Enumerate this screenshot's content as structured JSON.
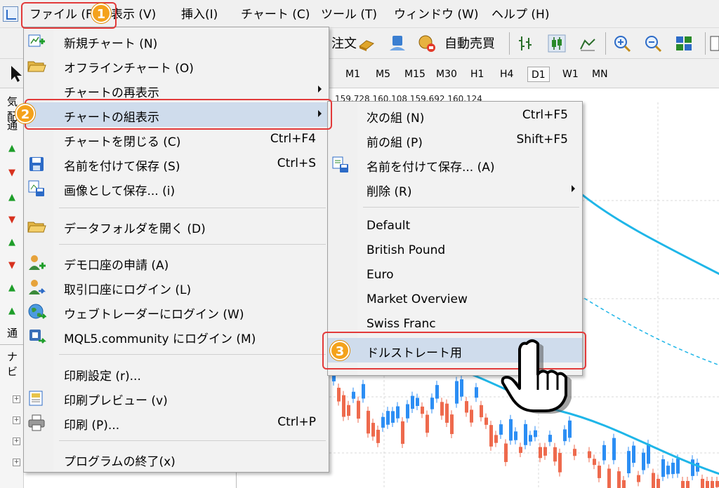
{
  "menubar": {
    "items": [
      "ファイル (F)",
      "表示 (V)",
      "挿入(I)",
      "チャート (C)",
      "ツール (T)",
      "ウィンドウ (W)",
      "ヘルプ (H)"
    ]
  },
  "toolbar": {
    "order_label": "注文",
    "auto_trade_label": "自動売買"
  },
  "timeframes": [
    "M1",
    "M5",
    "M15",
    "M30",
    "H1",
    "H4",
    "D1",
    "W1",
    "MN"
  ],
  "active_timeframe": "D1",
  "left_panel": {
    "market_watch_title": "気配",
    "tab_label": "通",
    "tab_label_2": "通",
    "navigator_title": "ナビ"
  },
  "chart": {
    "price_row": "159.728 160.108 159.692 160.124"
  },
  "file_menu": {
    "items": [
      {
        "label": "新規チャート (N)",
        "shortcut": "",
        "icon": "new-chart-icon"
      },
      {
        "label": "オフラインチャート (O)",
        "shortcut": "",
        "icon": "open-folder-icon"
      },
      {
        "label": "チャートの再表示",
        "shortcut": "",
        "icon": "none"
      },
      {
        "label": "チャートの組表示",
        "shortcut": "",
        "icon": "none"
      },
      {
        "label": "チャートを閉じる (C)",
        "shortcut": "Ctrl+F4",
        "icon": "none"
      },
      {
        "label": "名前を付けて保存 (S)",
        "shortcut": "Ctrl+S",
        "icon": "save-icon"
      },
      {
        "label": "画像として保存... (i)",
        "shortcut": "",
        "icon": "save-image-icon"
      },
      {
        "label": "データフォルダを開く (D)",
        "shortcut": "",
        "icon": "folder-icon"
      },
      {
        "label": "デモ口座の申請 (A)",
        "shortcut": "",
        "icon": "add-user-icon"
      },
      {
        "label": "取引口座にログイン (L)",
        "shortcut": "",
        "icon": "login-user-icon"
      },
      {
        "label": "ウェブトレーダーにログイン (W)",
        "shortcut": "",
        "icon": "globe-icon"
      },
      {
        "label": "MQL5.community にログイン (M)",
        "shortcut": "",
        "icon": "mql5-icon"
      },
      {
        "label": "印刷設定 (r)...",
        "shortcut": "",
        "icon": "none"
      },
      {
        "label": "印刷プレビュー (v)",
        "shortcut": "",
        "icon": "print-preview-icon"
      },
      {
        "label": "印刷 (P)...",
        "shortcut": "Ctrl+P",
        "icon": "printer-icon"
      },
      {
        "label": "プログラムの終了(x)",
        "shortcut": "",
        "icon": "none"
      }
    ]
  },
  "profiles_menu": {
    "items": [
      {
        "label": "次の組 (N)",
        "shortcut": "Ctrl+F5"
      },
      {
        "label": "前の組 (P)",
        "shortcut": "Shift+F5"
      },
      {
        "label": "名前を付けて保存... (A)",
        "shortcut": ""
      },
      {
        "label": "削除 (R)",
        "shortcut": ""
      },
      {
        "label": "Default",
        "shortcut": ""
      },
      {
        "label": "British Pound",
        "shortcut": ""
      },
      {
        "label": "Euro",
        "shortcut": ""
      },
      {
        "label": "Market Overview",
        "shortcut": ""
      },
      {
        "label": "Swiss Franc",
        "shortcut": ""
      },
      {
        "label": "ドルストレート用",
        "shortcut": ""
      }
    ]
  },
  "steps": [
    "1",
    "2",
    "3"
  ],
  "colors": {
    "highlight": "#cfdcec",
    "annotation_red": "#e23a3a",
    "step_orange": "#f4a21b",
    "bull_candle": "#2c8ef4",
    "bear_candle": "#ee6a4d",
    "moving_average": "#1fb6e8"
  }
}
